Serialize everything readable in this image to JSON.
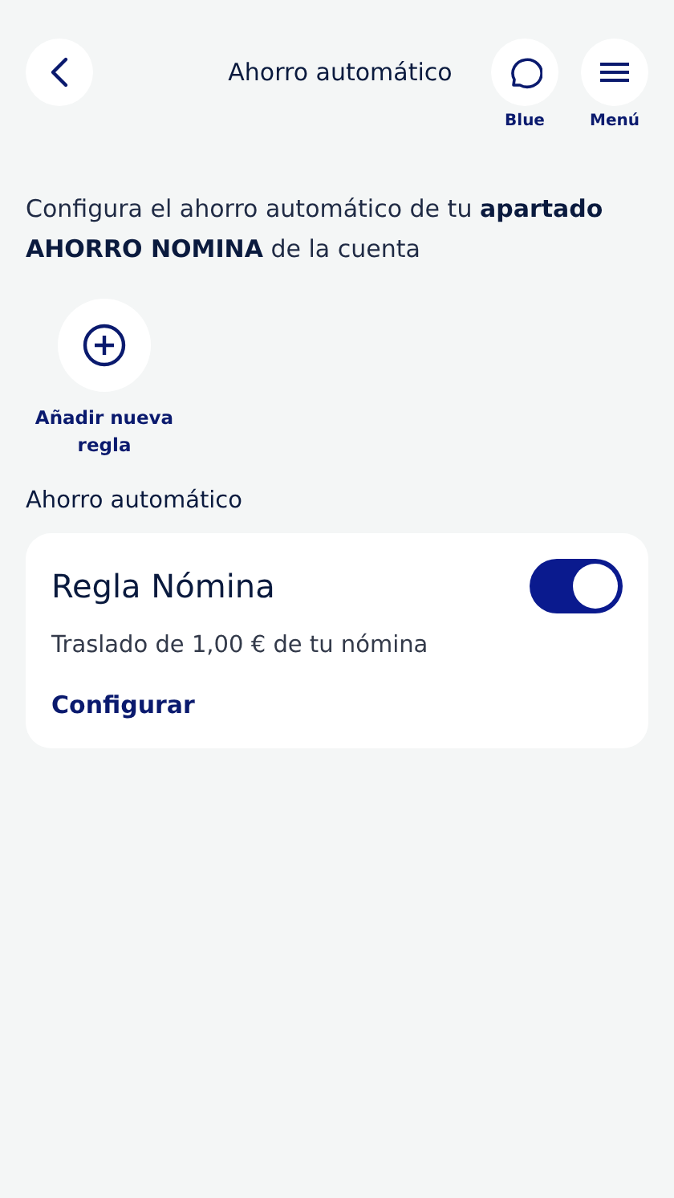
{
  "header": {
    "title": "Ahorro automático",
    "actions": [
      {
        "kind": "chat",
        "label": "Blue"
      },
      {
        "kind": "menu",
        "label": "Menú"
      }
    ]
  },
  "intro": "Configura el ahorro automático de tu **apartado AHORRO NOMINA** de la cuenta",
  "add_rule": {
    "label": "Añadir nueva regla"
  },
  "section_title": "Ahorro automático",
  "rules": [
    {
      "name": "Regla Nómina",
      "on": true,
      "description": "Traslado de 1,00 € de tu nómina",
      "link": "Configurar"
    }
  ]
}
